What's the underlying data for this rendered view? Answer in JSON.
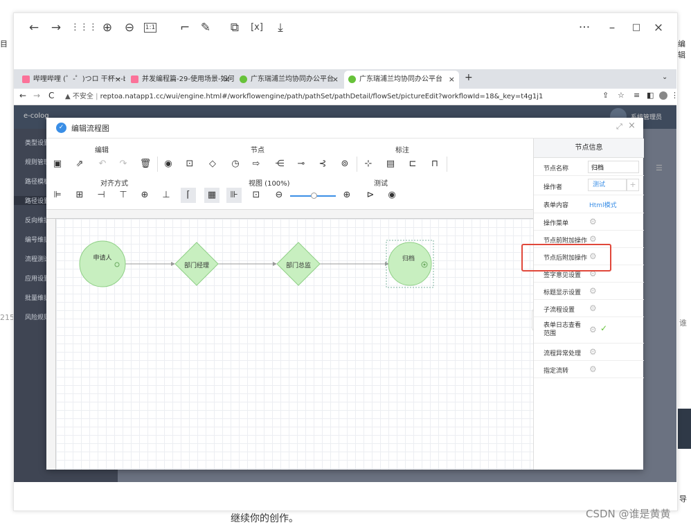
{
  "viewer": {
    "zoom_in": "⊕",
    "zoom_out": "⊖",
    "actual_size": "1:1",
    "more": "···",
    "minimize": "–",
    "maximize": "□",
    "close": "×"
  },
  "browser": {
    "tabs": [
      {
        "label": "哔哩哔哩 (゜-゜)つロ 干杯~-bili",
        "close": "×"
      },
      {
        "label": "并发编程篇-29-使用场景-如何...",
        "close": "×"
      },
      {
        "label": "广东瑞浦兰均协同办公平台",
        "close": "×"
      },
      {
        "label": "广东瑞浦兰均协同办公平台",
        "close": "×"
      }
    ],
    "new_tab": "+",
    "insecure": "▲ 不安全",
    "url": "reptoa.natapp1.cc/wui/engine.html#/workflowengine/path/pathSet/pathDetail/flowSet/pictureEdit?workflowId=18&_key=t4g1j1"
  },
  "app": {
    "brand": "e-colog",
    "user": "系统管理员",
    "sidebar": [
      "类型设置",
      "规则管理",
      "路径模板",
      "路径设置",
      "反向维护",
      "编号维护",
      "流程测试",
      "应用设置",
      "批量维护",
      "风险规则"
    ]
  },
  "modal": {
    "title": "编辑流程图",
    "groups": {
      "edit": "编辑",
      "node": "节点",
      "mark": "标注",
      "align": "对齐方式",
      "view": "视图 (100%)",
      "test": "测试"
    },
    "nodes": [
      {
        "label": "申请人"
      },
      {
        "label": "部门经理"
      },
      {
        "label": "部门总监"
      },
      {
        "label": "归档"
      }
    ]
  },
  "panel": {
    "title": "节点信息",
    "node_name_label": "节点名称",
    "node_name_value": "归档",
    "operator_label": "操作者",
    "operator_value": "测试",
    "form_label": "表单内容",
    "form_value": "Html模式",
    "rows": [
      "操作菜单",
      "节点前附加操作",
      "节点后附加操作",
      "签字意见设置",
      "标题显示设置",
      "子流程设置",
      "表单日志查看范围",
      "流程异常处理",
      "指定流转"
    ]
  },
  "page": {
    "right_fragment_1": "编辑",
    "right_fragment_2": "谁",
    "right_fragment_3": "导",
    "left_fragment": "215",
    "body_text": "继续你的创作。",
    "watermark": "CSDN @谁是黄黄"
  },
  "colors": {
    "accent": "#3a8ee6",
    "node_fill": "#c8efc0",
    "node_stroke": "#8fcf86",
    "highlight": "#e0473a"
  }
}
